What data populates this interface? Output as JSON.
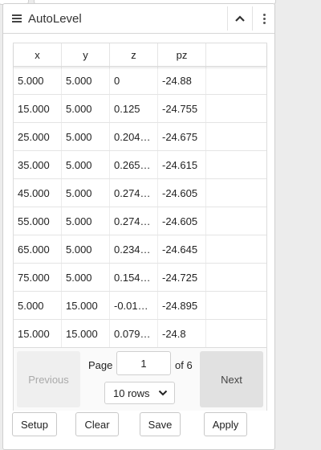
{
  "panel": {
    "title": "AutoLevel",
    "icons": {
      "menu": "hamburger-icon",
      "collapse": "chevron-up-icon",
      "more": "kebab-menu-icon"
    }
  },
  "table": {
    "columns": [
      "x",
      "y",
      "z",
      "pz"
    ],
    "rows": [
      [
        "5.000",
        "5.000",
        "0",
        "-24.88"
      ],
      [
        "15.000",
        "5.000",
        "0.125",
        "-24.755"
      ],
      [
        "25.000",
        "5.000",
        "0.204…",
        "-24.675"
      ],
      [
        "35.000",
        "5.000",
        "0.265…",
        "-24.615"
      ],
      [
        "45.000",
        "5.000",
        "0.274…",
        "-24.605"
      ],
      [
        "55.000",
        "5.000",
        "0.274…",
        "-24.605"
      ],
      [
        "65.000",
        "5.000",
        "0.234…",
        "-24.645"
      ],
      [
        "75.000",
        "5.000",
        "0.154…",
        "-24.725"
      ],
      [
        "5.000",
        "15.000",
        "-0.01…",
        "-24.895"
      ],
      [
        "15.000",
        "15.000",
        "0.079…",
        "-24.8"
      ]
    ]
  },
  "pagination": {
    "previous_label": "Previous",
    "next_label": "Next",
    "page_label": "Page",
    "current_page": "1",
    "of_label": "of 6",
    "rows_option": "10 rows"
  },
  "actions": {
    "setup": "Setup",
    "clear": "Clear",
    "save": "Save",
    "apply": "Apply"
  }
}
